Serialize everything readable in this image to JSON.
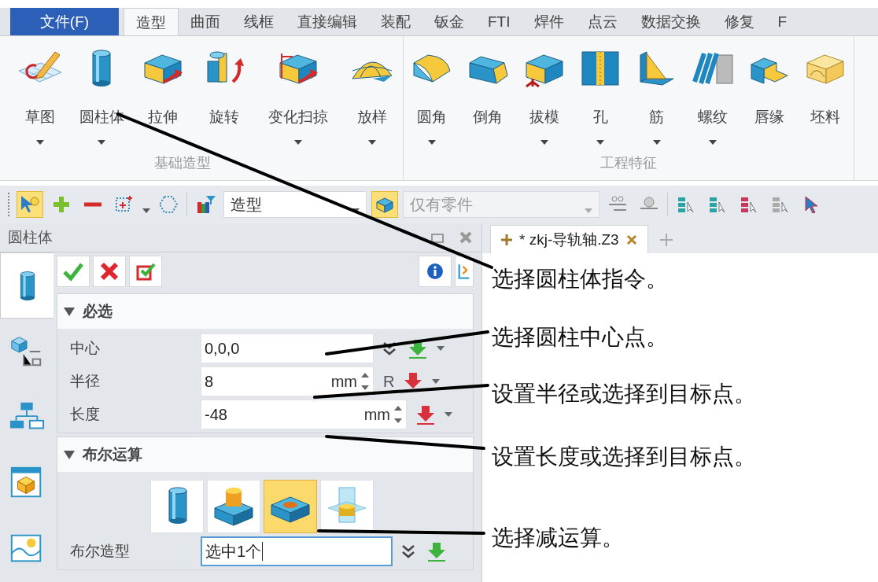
{
  "menu_tabs": [
    {
      "label": "文件(F)",
      "kind": "file",
      "selected": false
    },
    {
      "label": "造型",
      "kind": "tab",
      "selected": true
    },
    {
      "label": "曲面",
      "kind": "tab",
      "selected": false
    },
    {
      "label": "线框",
      "kind": "tab",
      "selected": false
    },
    {
      "label": "直接编辑",
      "kind": "tab",
      "selected": false
    },
    {
      "label": "装配",
      "kind": "tab",
      "selected": false
    },
    {
      "label": "钣金",
      "kind": "tab",
      "selected": false
    },
    {
      "label": "FTI",
      "kind": "tab",
      "selected": false
    },
    {
      "label": "焊件",
      "kind": "tab",
      "selected": false
    },
    {
      "label": "点云",
      "kind": "tab",
      "selected": false
    },
    {
      "label": "数据交换",
      "kind": "tab",
      "selected": false
    },
    {
      "label": "修复",
      "kind": "tab",
      "selected": false
    },
    {
      "label": "F",
      "kind": "tab",
      "selected": false
    }
  ],
  "ribbon_groups": [
    {
      "title": "基础造型",
      "items": [
        {
          "label": "草图",
          "dropdown": true
        },
        {
          "label": "圆柱体",
          "dropdown": true
        },
        {
          "label": "拉伸",
          "dropdown": false
        },
        {
          "label": "旋转",
          "dropdown": false
        },
        {
          "label": "变化扫掠",
          "dropdown": true
        },
        {
          "label": "放样",
          "dropdown": true
        }
      ]
    },
    {
      "title": "工程特征",
      "items": [
        {
          "label": "圆角",
          "dropdown": true
        },
        {
          "label": "倒角",
          "dropdown": false
        },
        {
          "label": "拔模",
          "dropdown": true
        },
        {
          "label": "孔",
          "dropdown": true
        },
        {
          "label": "筋",
          "dropdown": true
        },
        {
          "label": "螺纹",
          "dropdown": true
        },
        {
          "label": "唇缘",
          "dropdown": false
        },
        {
          "label": "坯料",
          "dropdown": false
        }
      ]
    }
  ],
  "toolbar": {
    "pick_tool_selected": true,
    "filter_value": "造型",
    "part_filter": {
      "value": "仅有零件",
      "disabled": true
    }
  },
  "panel": {
    "title": "圆柱体",
    "side_tabs": [
      {
        "selected": true
      },
      {
        "selected": false
      },
      {
        "selected": false
      },
      {
        "selected": false
      },
      {
        "selected": false
      }
    ],
    "sections": [
      {
        "title": "必选",
        "expanded": true,
        "fields": [
          {
            "label": "中心",
            "value": "0,0,0",
            "kind": "point",
            "color": "#3cb33c",
            "has_menu": true,
            "focused": false
          },
          {
            "label": "半径",
            "value": "8",
            "unit": "mm",
            "extra": "R",
            "kind": "number",
            "color": "#d9303d",
            "has_menu": true,
            "focused": false
          },
          {
            "label": "长度",
            "value": "-48",
            "unit": "mm",
            "kind": "number",
            "color": "#d9303d",
            "has_menu": true,
            "focused": false
          }
        ]
      },
      {
        "title": "布尔运算",
        "expanded": true,
        "options": [
          {
            "selected": false
          },
          {
            "selected": false
          },
          {
            "selected": true
          },
          {
            "selected": false
          }
        ],
        "fields": [
          {
            "label": "布尔造型",
            "value": "选中1个",
            "kind": "entity",
            "color": "#3cb33c",
            "has_menu": false,
            "focused": true
          }
        ]
      }
    ]
  },
  "document_tabs": [
    {
      "label": "* zkj-导轨轴.Z3",
      "selected": true
    }
  ],
  "annotations": [
    "选择圆柱体指令。",
    "选择圆柱中心点。",
    "设置半径或选择到目标点。",
    "设置长度或选择到目标点。",
    "选择减运算。"
  ]
}
